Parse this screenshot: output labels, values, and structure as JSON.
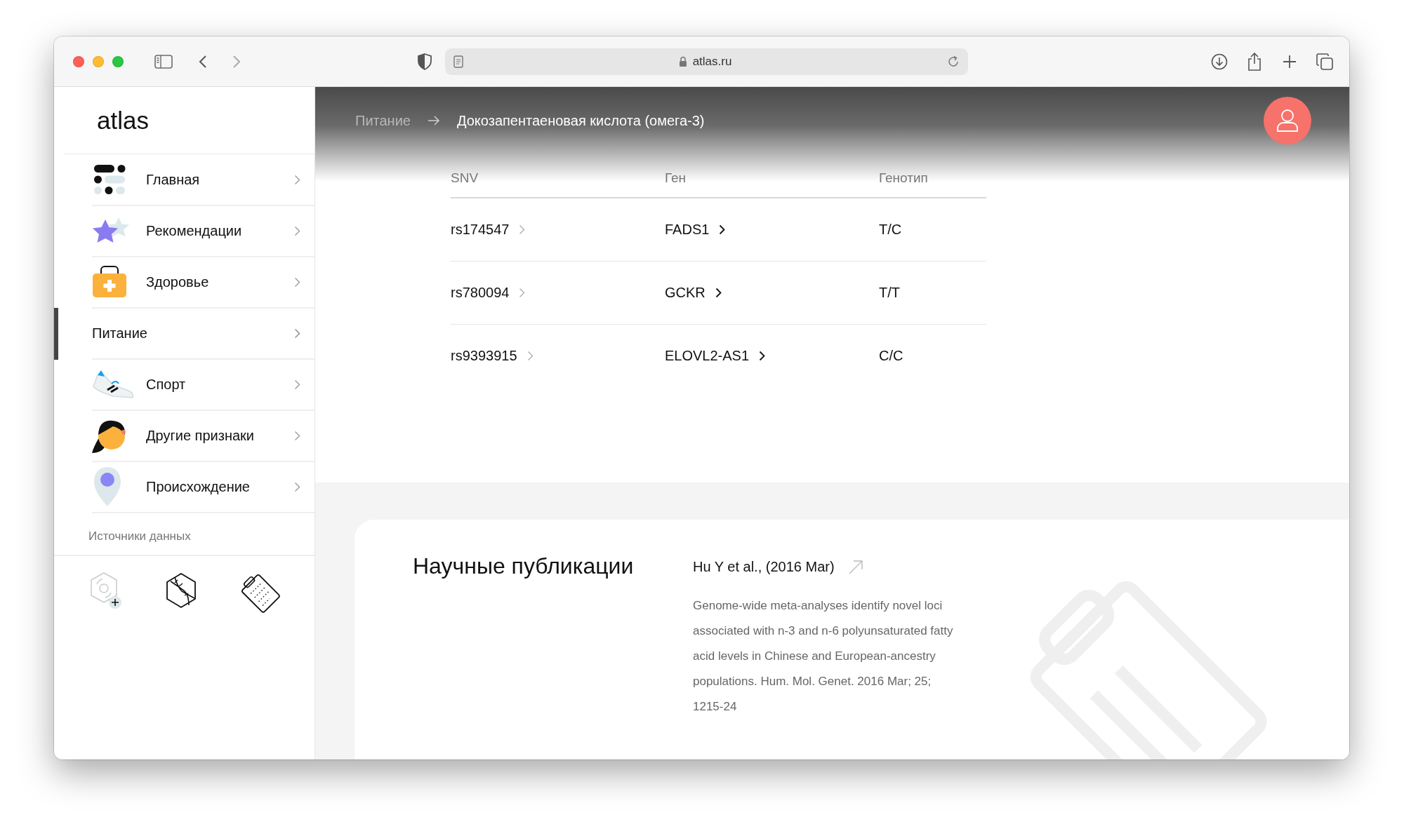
{
  "browser": {
    "url": "atlas.ru"
  },
  "sidebar": {
    "logo": "atlas",
    "items": [
      {
        "label": "Главная",
        "selected": false
      },
      {
        "label": "Рекомендации",
        "selected": false
      },
      {
        "label": "Здоровье",
        "selected": false
      },
      {
        "label": "Питание",
        "selected": true
      },
      {
        "label": "Спорт",
        "selected": false
      },
      {
        "label": "Другие признаки",
        "selected": false
      },
      {
        "label": "Происхождение",
        "selected": false
      }
    ],
    "data_sources": {
      "label": "Источники данных"
    }
  },
  "breadcrumb": [
    {
      "label": "Питание",
      "current": false
    },
    {
      "label": "Докозапентаеновая кислота (омега-3)",
      "current": true
    }
  ],
  "table": {
    "columns": [
      "SNV",
      "Ген",
      "Генотип"
    ],
    "rows": [
      {
        "snv": "rs174547",
        "gene": "FADS1",
        "genotype": "T/C"
      },
      {
        "snv": "rs780094",
        "gene": "GCKR",
        "genotype": "T/T"
      },
      {
        "snv": "rs9393915",
        "gene": "ELOVL2-AS1",
        "genotype": "C/C"
      }
    ]
  },
  "publications": {
    "title": "Научные публикации",
    "items": [
      {
        "author": "Hu Y et al., (2016 Mar)",
        "abstract": "Genome-wide meta-analyses identify novel loci associated with n-3 and n-6 polyunsaturated fatty acid levels in Chinese and European-ancestry populations. Hum. Mol. Genet. 2016 Mar; 25; 1215-24"
      }
    ]
  }
}
